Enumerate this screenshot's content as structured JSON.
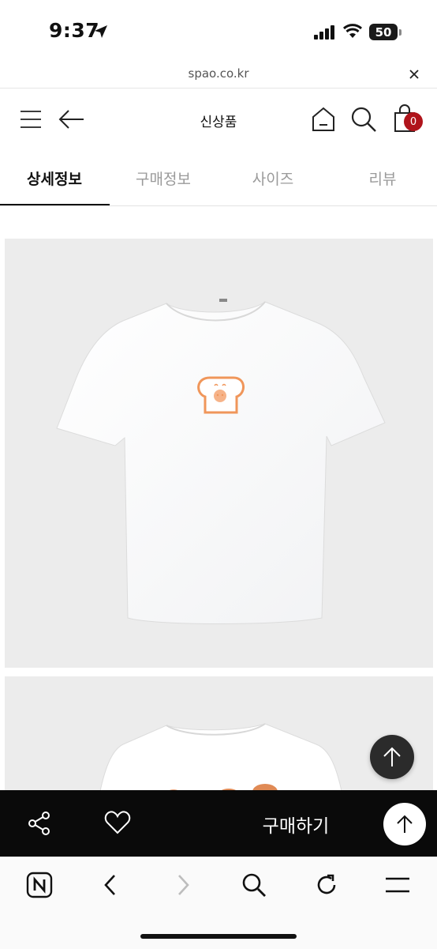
{
  "status_bar": {
    "time": "9:37",
    "battery": "50"
  },
  "browser": {
    "url": "spao.co.kr"
  },
  "header": {
    "title": "신상품",
    "cart_count": "0"
  },
  "tabs": [
    {
      "label": "상세정보",
      "active": true
    },
    {
      "label": "구매정보",
      "active": false
    },
    {
      "label": "사이즈",
      "active": false
    },
    {
      "label": "리뷰",
      "active": false
    }
  ],
  "buy_bar": {
    "buy_label": "구매하기"
  },
  "colors": {
    "accent_badge": "#b0141b",
    "buy_bar": "#0a0a0a",
    "print_orange": "#f0965a"
  },
  "icons": [
    "location-arrow-icon",
    "signal-icon",
    "wifi-icon",
    "close-icon",
    "menu-icon",
    "back-arrow-icon",
    "home-icon",
    "search-icon",
    "cart-icon",
    "arrow-up-icon",
    "share-icon",
    "heart-icon",
    "naver-icon",
    "chevron-left-icon",
    "chevron-right-icon",
    "refresh-icon"
  ]
}
